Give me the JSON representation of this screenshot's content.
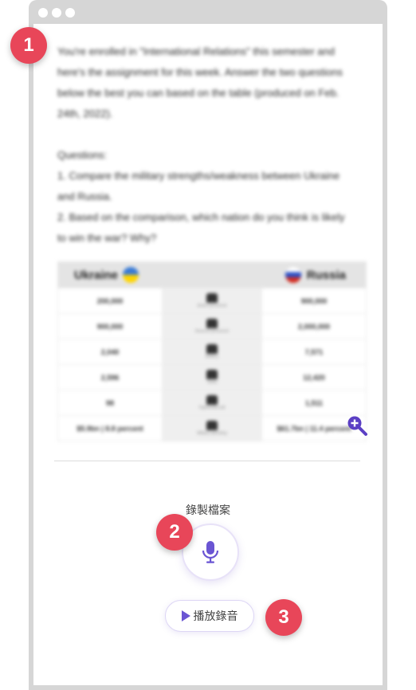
{
  "passage": {
    "lines": [
      "You're enrolled in \"International Relations\" this semester and",
      "here's the assignment for this week. Answer the two questions",
      "below the best you can based on the table (produced on Feb.",
      "24th, 2022).",
      "",
      "Questions:",
      "1. Compare the military strengths/weakness between Ukraine",
      "and Russia.",
      "2. Based on the comparison, which nation do you think is likely",
      "to win the war? Why?"
    ]
  },
  "table": {
    "left_header": "Ukraine",
    "right_header": "Russia",
    "rows": [
      {
        "left": "200,000",
        "middle": "Active personnel",
        "right": "900,000",
        "icon": "soldier-icon"
      },
      {
        "left": "900,000",
        "middle": "Reserve personnel",
        "right": "2,000,000",
        "icon": "reserve-icon"
      },
      {
        "left": "2,040",
        "middle": "Artillery",
        "right": "7,571",
        "icon": "artillery-icon"
      },
      {
        "left": "2,596",
        "middle": "Tanks",
        "right": "12,420",
        "icon": "tank-icon"
      },
      {
        "left": "98",
        "middle": "Fighter/Aircraft",
        "right": "1,511",
        "icon": "aircraft-icon"
      },
      {
        "left": "$5.9bn | 8.8 percent",
        "middle": "Military spending",
        "right": "$61.7bn | 11.4 percent",
        "icon": "money-icon"
      }
    ]
  },
  "recording": {
    "label": "錄製檔案",
    "play_label": "播放錄音"
  },
  "badges": [
    "1",
    "2",
    "3"
  ],
  "colors": {
    "accent": "#6a55d3",
    "badge": "#e84659",
    "zoom": "#5b3fc4"
  }
}
